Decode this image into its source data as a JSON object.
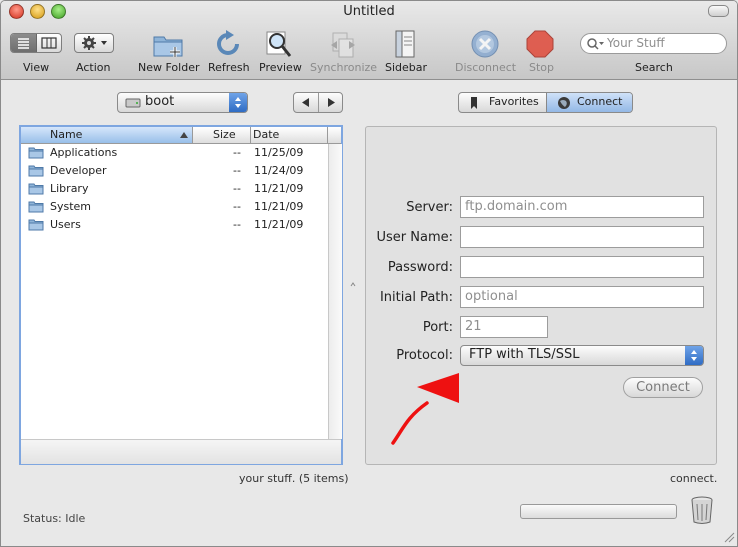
{
  "window": {
    "title": "Untitled"
  },
  "toolbar": {
    "view_label": "View",
    "action_label": "Action",
    "new_folder_label": "New Folder",
    "refresh_label": "Refresh",
    "preview_label": "Preview",
    "synchronize_label": "Synchronize",
    "sidebar_label": "Sidebar",
    "disconnect_label": "Disconnect",
    "stop_label": "Stop",
    "search_label": "Search",
    "search_placeholder": "Your Stuff"
  },
  "browser": {
    "volume": "boot",
    "columns": {
      "name": "Name",
      "size": "Size",
      "date": "Date"
    },
    "files": [
      {
        "name": "Applications",
        "size": "--",
        "date": "11/25/09",
        "icon": "applications-folder-icon"
      },
      {
        "name": "Developer",
        "size": "--",
        "date": "11/24/09",
        "icon": "developer-folder-icon"
      },
      {
        "name": "Library",
        "size": "--",
        "date": "11/21/09",
        "icon": "library-folder-icon"
      },
      {
        "name": "System",
        "size": "--",
        "date": "11/21/09",
        "icon": "system-folder-icon"
      },
      {
        "name": "Users",
        "size": "--",
        "date": "11/21/09",
        "icon": "users-folder-icon"
      }
    ],
    "footer": "your stuff. (5 items)"
  },
  "connect_panel": {
    "tabs": {
      "favorites": "Favorites",
      "connect": "Connect"
    },
    "server_label": "Server:",
    "server_placeholder": "ftp.domain.com",
    "username_label": "User Name:",
    "username_value": "",
    "password_label": "Password:",
    "password_value": "",
    "initial_path_label": "Initial Path:",
    "initial_path_placeholder": "optional",
    "port_label": "Port:",
    "port_placeholder": "21",
    "protocol_label": "Protocol:",
    "protocol_value": "FTP with TLS/SSL",
    "connect_button": "Connect",
    "footer": "connect."
  },
  "status": {
    "text": "Status: Idle"
  },
  "colors": {
    "accent": "#3b78d8",
    "annotation_arrow": "#ee1111"
  }
}
